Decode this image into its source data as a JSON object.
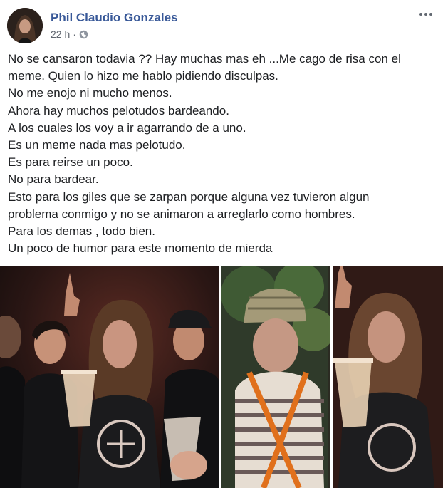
{
  "post": {
    "author": "Phil Claudio Gonzales",
    "timestamp": "22 h",
    "separator": "·",
    "privacy_icon": "globe-icon",
    "more_icon": "more-options-icon",
    "lines": [
      "No se cansaron todavia ?? Hay muchas mas eh ...Me cago de risa con el",
      "meme. Quien lo hizo me hablo pidiendo disculpas.",
      "No me enojo ni mucho menos.",
      "Ahora hay muchos pelotudos bardeando.",
      "A los cuales los voy a ir agarrando de a uno.",
      "Es un meme nada mas pelotudo.",
      "Es para reirse un poco.",
      "No para bardear.",
      "Esto para los giles que se zarpan porque alguna vez tuvieron algun",
      "problema conmigo y no se animaron a arreglarlo como hombres.",
      "Para los demas , todo bien.",
      "Un poco de humor para este momento de mierda"
    ]
  },
  "colors": {
    "author": "#385898",
    "text": "#1c1e21",
    "meta": "#616770"
  }
}
